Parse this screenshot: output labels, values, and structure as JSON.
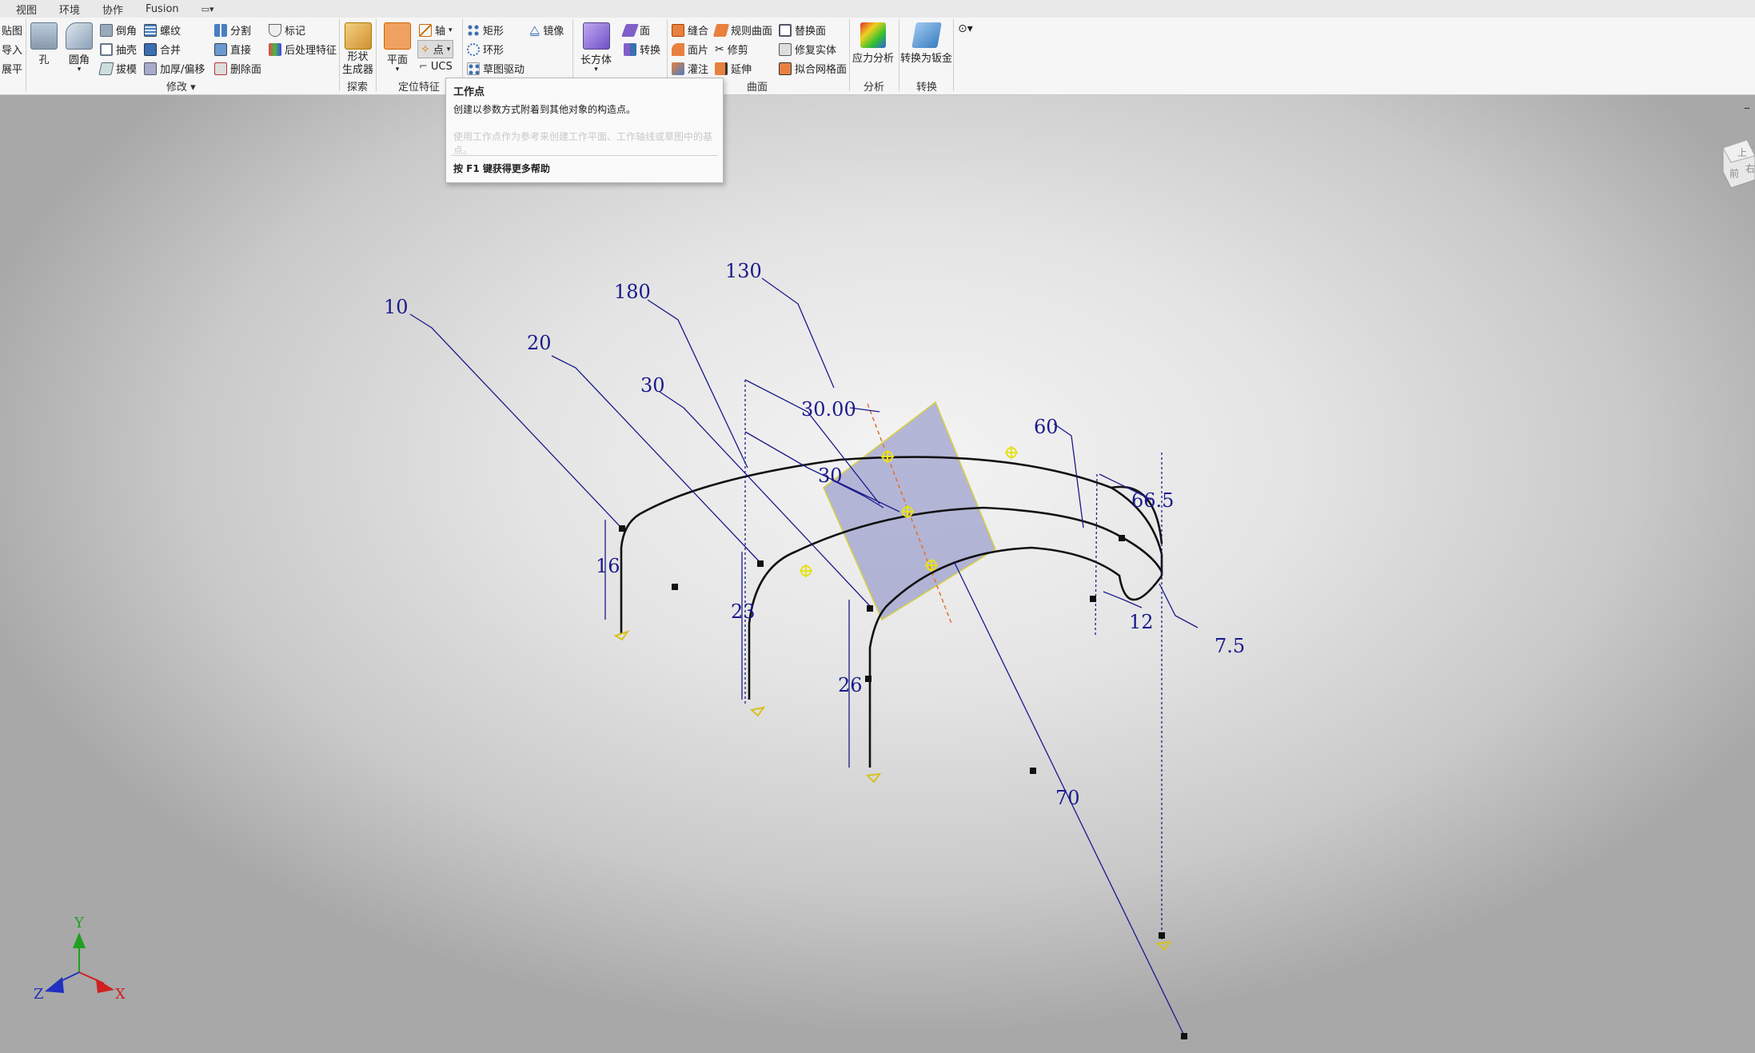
{
  "menu": {
    "tabs": [
      "视图",
      "环境",
      "协作",
      "Fusion"
    ]
  },
  "ribbon": {
    "left_items": [
      "贴图",
      "导入",
      "展平"
    ],
    "modify": {
      "hole": "孔",
      "fillet": "圆角",
      "chamfer": "倒角",
      "shell": "抽壳",
      "draft": "拔模",
      "thread": "螺纹",
      "combine": "合并",
      "thicken": "加厚/偏移",
      "split": "分割",
      "direct": "直接",
      "delete_face": "删除面",
      "mark": "标记",
      "postprocess": "后处理特征",
      "label": "修改"
    },
    "explore": {
      "shape_gen": "形状\n生成器",
      "label": "探索"
    },
    "work": {
      "plane": "平面",
      "axis": "轴",
      "point": "点",
      "ucs": "UCS",
      "label": "定位特征"
    },
    "pattern": {
      "rect": "矩形",
      "circ": "环形",
      "sketch_drive": "草图驱动",
      "mirror": "镜像"
    },
    "create": {
      "box": "长方体",
      "face": "面",
      "convert": "转换"
    },
    "surface": {
      "stitch": "缝合",
      "ruled": "规则曲面",
      "replace": "替换面",
      "patch": "面片",
      "trim": "修剪",
      "repair": "修复实体",
      "sculpt": "灌注",
      "extend": "延伸",
      "fit_mesh": "拟合网格面",
      "label": "曲面"
    },
    "analysis": {
      "stress": "应力分析",
      "label": "分析"
    },
    "convert": {
      "sheet": "转换为钣金",
      "label": "转换"
    }
  },
  "tooltip": {
    "title": "工作点",
    "description": "创建以参数方式附着到其他对象的构造点。",
    "faded": "使用工作点作为参考来创建工作平面、工作轴线或草图中的基点。",
    "help": "按 F1 键获得更多帮助"
  },
  "dimensions": {
    "d10": "10",
    "d20": "20",
    "d180": "180",
    "d130": "130",
    "d30a": "30",
    "d30b": "30",
    "d3000": "30.00",
    "d60": "60",
    "d665": "66.5",
    "d75": "7.5",
    "d12": "12",
    "d16": "16",
    "d23": "23",
    "d26": "26",
    "d70": "70"
  },
  "triad": {
    "x": "X",
    "y": "Y",
    "z": "Z"
  },
  "viewcube": {
    "top": "上",
    "front": "前",
    "right": "右"
  },
  "colors": {
    "dimension": "#1a1a8c",
    "plane": "#8a8ec4",
    "workpoint": "#e6e020",
    "axis_x": "#d02020",
    "axis_y": "#20a020",
    "axis_z": "#2030c0"
  }
}
